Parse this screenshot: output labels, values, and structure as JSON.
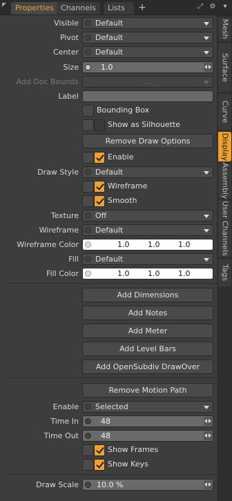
{
  "window": {
    "tabs": [
      "Properties",
      "Channels",
      "Lists"
    ],
    "add_tab": "+"
  },
  "side_tabs": [
    "Mesh",
    "Surface",
    "Curve",
    "Display",
    "Assembly",
    "User Channels",
    "Tags"
  ],
  "form": {
    "visible": {
      "label": "Visible",
      "value": "Default"
    },
    "pivot": {
      "label": "Pivot",
      "value": "Default"
    },
    "center": {
      "label": "Center",
      "value": "Default"
    },
    "size": {
      "label": "Size",
      "value": "1.0"
    },
    "add_doc_bounds": {
      "label": "Add Doc Bounds",
      "value": "..."
    },
    "label": {
      "label": "Label",
      "value": ""
    },
    "bounding_box": "Bounding Box",
    "show_silhouette": "Show as Silhouette",
    "remove_draw_options": "Remove Draw Options",
    "enable": "Enable",
    "draw_style": {
      "label": "Draw Style",
      "value": "Default"
    },
    "wireframe_cb": "Wireframe",
    "smooth_cb": "Smooth",
    "texture": {
      "label": "Texture",
      "value": "Off"
    },
    "wireframe": {
      "label": "Wireframe",
      "value": "Default"
    },
    "wireframe_color": {
      "label": "Wireframe Color",
      "r": "1.0",
      "g": "1.0",
      "b": "1.0"
    },
    "fill": {
      "label": "Fill",
      "value": "Default"
    },
    "fill_color": {
      "label": "Fill Color",
      "r": "1.0",
      "g": "1.0",
      "b": "1.0"
    },
    "add_dimensions": "Add Dimensions",
    "add_notes": "Add Notes",
    "add_meter": "Add Meter",
    "add_level_bars": "Add Level Bars",
    "add_opensubdiv": "Add OpenSubdiv DrawOver",
    "remove_motion_path": "Remove Motion Path",
    "mp_enable": {
      "label": "Enable",
      "value": "Selected"
    },
    "time_in": {
      "label": "Time In",
      "value": "48"
    },
    "time_out": {
      "label": "Time Out",
      "value": "48"
    },
    "show_frames": "Show Frames",
    "show_keys": "Show Keys",
    "draw_scale": {
      "label": "Draw Scale",
      "value": "10.0 %"
    }
  },
  "colors": {
    "accent": "#f0a030",
    "panel": "#3d3d3d",
    "field": "#4a4a4a"
  }
}
